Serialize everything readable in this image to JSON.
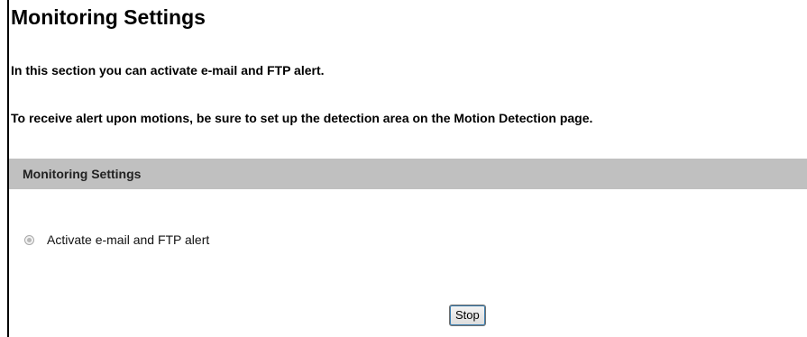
{
  "page": {
    "title": "Monitoring Settings",
    "intro": "In this section you can activate e-mail and FTP alert.",
    "note": "To receive alert upon motions, be sure to set up the detection area on the Motion Detection page."
  },
  "section": {
    "header": "Monitoring Settings",
    "radio_label": "Activate e-mail and FTP alert",
    "radio_checked": true
  },
  "actions": {
    "stop_label": "Stop"
  },
  "colors": {
    "section_header_bg": "#c0c0c0",
    "button_focus": "#3c7fb1"
  }
}
